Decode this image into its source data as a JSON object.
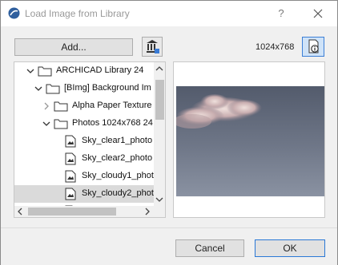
{
  "window": {
    "title": "Load Image from Library",
    "help_label": "?",
    "close_icon": "close-icon"
  },
  "toolbar": {
    "add_label": "Add...",
    "library_icon": "library-manager-icon",
    "resolution": "1024x768",
    "info_icon": "image-info-icon"
  },
  "tree": {
    "items": [
      {
        "label": "ARCHICAD Library 24",
        "type": "folder",
        "depth": 1,
        "expanded": true
      },
      {
        "label": "[BImg] Background Im",
        "type": "folder",
        "depth": 2,
        "expanded": true
      },
      {
        "label": "Alpha Paper Texture",
        "type": "folder",
        "depth": 3,
        "expanded": false
      },
      {
        "label": "Photos 1024x768 24",
        "type": "folder",
        "depth": 3,
        "expanded": true
      },
      {
        "label": "Sky_clear1_photo",
        "type": "image",
        "depth": 4
      },
      {
        "label": "Sky_clear2_photo",
        "type": "image",
        "depth": 4
      },
      {
        "label": "Sky_cloudy1_phot",
        "type": "image",
        "depth": 4
      },
      {
        "label": "Sky_cloudy2_phot",
        "type": "image",
        "depth": 4,
        "selected": true
      }
    ]
  },
  "footer": {
    "cancel_label": "Cancel",
    "ok_label": "OK"
  },
  "colors": {
    "accent": "#2a78d6",
    "selection": "#dadada",
    "sky_top": "#5b6374",
    "sky_bottom": "#8a93a4"
  }
}
